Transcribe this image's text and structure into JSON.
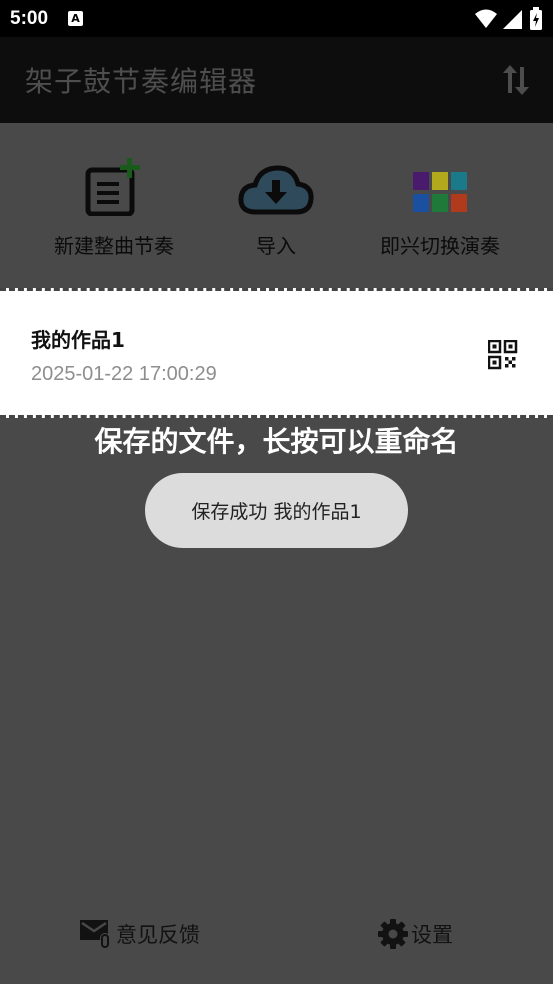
{
  "status_bar": {
    "time": "5:00",
    "notification_icon": "A",
    "icons": [
      "wifi-icon",
      "signal-icon",
      "battery-icon"
    ]
  },
  "app_bar": {
    "title": "架子鼓节奏编辑器",
    "sort_icon": "sort-arrows-icon"
  },
  "actions": [
    {
      "label": "新建整曲节奏",
      "icon": "new-document-icon"
    },
    {
      "label": "导入",
      "icon": "cloud-download-icon"
    },
    {
      "label": "即兴切换演奏",
      "icon": "color-grid-icon"
    }
  ],
  "files": [
    {
      "name": "我的作品1",
      "date": "2025-01-22 17:00:29",
      "icon": "qr-code-icon"
    }
  ],
  "hint": "保存的文件，长按可以重命名",
  "toast": "保存成功 我的作品1",
  "bottom": {
    "feedback_label": "意见反馈",
    "settings_label": "设置"
  },
  "colors": {
    "background": "#484848",
    "app_bar": "#0d0d0d",
    "grid": [
      "#4a1a6c",
      "#b3a91c",
      "#1a7a8a",
      "#1b4fa0",
      "#1f7a3a",
      "#b03a1c"
    ]
  }
}
